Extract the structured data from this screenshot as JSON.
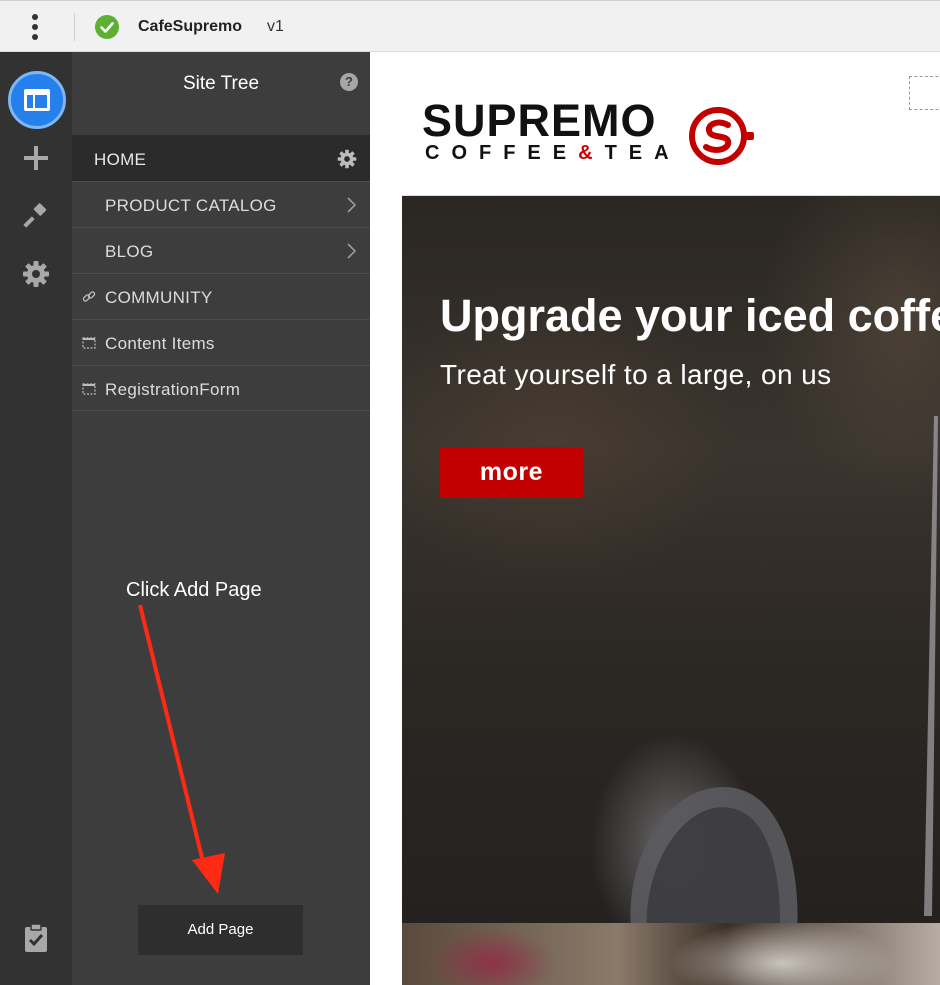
{
  "topbar": {
    "site_name": "CafeSupremo",
    "version": "v1",
    "menu_icon": "kebab-menu-icon",
    "status_icon": "check-circle-icon",
    "status_color": "#5cb032"
  },
  "rail": {
    "items": [
      {
        "name": "site-tree",
        "icon": "layout-icon",
        "active": true
      },
      {
        "name": "add",
        "icon": "plus-icon"
      },
      {
        "name": "design",
        "icon": "brush-icon"
      },
      {
        "name": "settings",
        "icon": "gear-icon"
      },
      {
        "name": "tasks",
        "icon": "clipboard-check-icon"
      }
    ],
    "active_color": "#2680eb"
  },
  "panel": {
    "title": "Site Tree",
    "help_glyph": "?",
    "items": [
      {
        "label": "HOME",
        "type": "home",
        "icon": "gear-icon"
      },
      {
        "label": "PRODUCT CATALOG",
        "type": "page",
        "icon": "chevron-right-icon"
      },
      {
        "label": "BLOG",
        "type": "page",
        "icon": "chevron-right-icon"
      },
      {
        "label": "COMMUNITY",
        "type": "link",
        "icon": "link-icon"
      },
      {
        "label": "Content Items",
        "type": "hidden",
        "icon": "dashed-page-icon"
      },
      {
        "label": "RegistrationForm",
        "type": "hidden",
        "icon": "dashed-page-icon"
      }
    ],
    "annotation": "Click Add Page",
    "annotation_color": "#ff2a14",
    "add_page_label": "Add Page"
  },
  "preview": {
    "logo_main": "SUPREMO",
    "logo_sub_left": "COFFEE",
    "logo_sub_amp": "&",
    "logo_sub_right": "TEA",
    "brand_color": "#c20000",
    "hero_title": "Upgrade your iced coffee",
    "hero_subtitle": "Treat yourself to a large, on us",
    "hero_button": "more"
  }
}
